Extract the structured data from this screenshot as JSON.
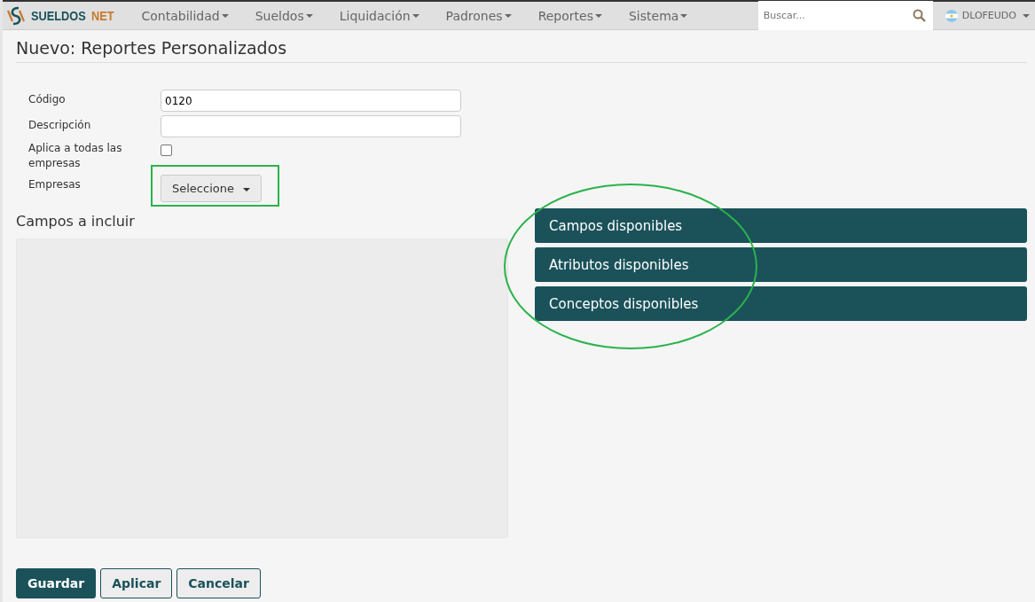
{
  "brand": {
    "name_part_1": "SUELDOS",
    "name_part_2": "NET"
  },
  "menu": [
    {
      "label": "Contabilidad"
    },
    {
      "label": "Sueldos"
    },
    {
      "label": "Liquidación"
    },
    {
      "label": "Padrones"
    },
    {
      "label": "Reportes"
    },
    {
      "label": "Sistema"
    }
  ],
  "search": {
    "placeholder": "Buscar..."
  },
  "user": {
    "name": "DLOFEUDO"
  },
  "page_title": "Nuevo: Reportes Personalizados",
  "form": {
    "codigo": {
      "label": "Código",
      "value": "0120"
    },
    "descripcion": {
      "label": "Descripción"
    },
    "aplica": {
      "label": "Aplica a todas las empresas",
      "checked": false
    },
    "empresas": {
      "label": "Empresas",
      "button": "Seleccione"
    }
  },
  "campos_title": "Campos a incluir",
  "panels": [
    {
      "label": "Campos disponibles"
    },
    {
      "label": "Atributos disponibles"
    },
    {
      "label": "Conceptos disponibles"
    }
  ],
  "buttons": [
    {
      "label": "Guardar",
      "kind": "primary"
    },
    {
      "label": "Aplicar",
      "kind": "default"
    },
    {
      "label": "Cancelar",
      "kind": "default"
    }
  ]
}
